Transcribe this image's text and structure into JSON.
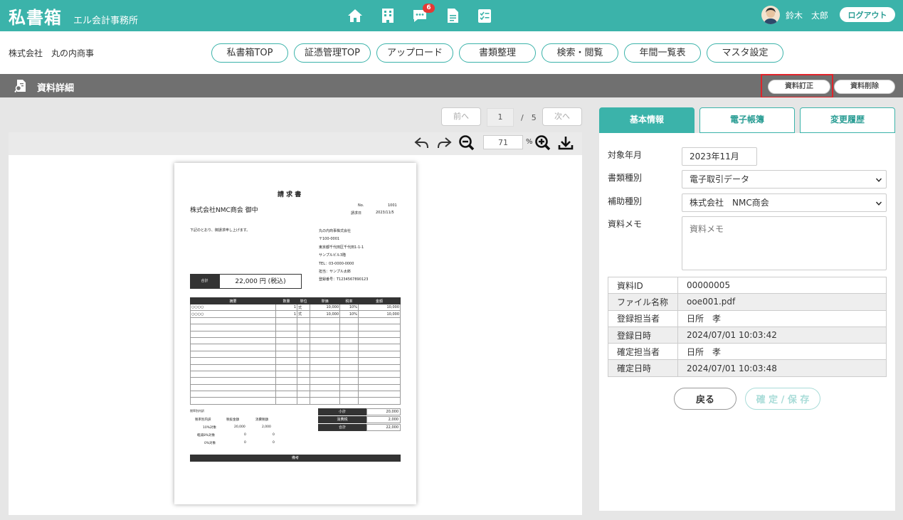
{
  "header": {
    "app_title": "私書箱",
    "office_name": "エル会計事務所",
    "notification_count": "6",
    "icons": [
      "home-icon",
      "building-icon",
      "chat-icon",
      "document-icon",
      "checklist-icon"
    ],
    "user_name": "鈴木　太郎",
    "logout_label": "ログアウト",
    "accent_color": "#3bb3aa"
  },
  "nav": {
    "company_name": "株式会社　丸の内商事",
    "items": [
      "私書箱TOP",
      "証憑管理TOP",
      "アップロード",
      "書類整理",
      "検索・閲覧",
      "年間一覧表",
      "マスタ設定"
    ]
  },
  "section": {
    "title": "資料詳細",
    "correct_label": "資料訂正",
    "delete_label": "資料削除"
  },
  "viewer": {
    "prev_label": "前へ",
    "next_label": "次へ",
    "current_page": "1",
    "total_pages": "/　5",
    "zoom_value": "71",
    "zoom_unit": "%"
  },
  "invoice": {
    "title": "請 求 書",
    "recipient": "株式会社NMC商会 御中",
    "no_label": "No.",
    "no_value": "1001",
    "date_label": "請求日",
    "date_value": "2023/11/5",
    "greeting": "下記のとおり、御請求申し上げます。",
    "sender_lines": [
      "丸の内商事株式会社",
      "〒100-0001",
      "東京都千代田区千代田1-1-1",
      "サンプルビル3階",
      "TEL：03-0000-0000",
      "担当：サンプル太郎",
      "登録番号：T1234567890123"
    ],
    "total_label": "合計",
    "total_value": "22,000 円 (税込)",
    "columns": [
      "摘要",
      "数量",
      "単位",
      "単価",
      "税率",
      "金額"
    ],
    "rows": [
      [
        "○○○○",
        "1",
        "式",
        "10,000",
        "10%",
        "10,000"
      ],
      [
        "○○○○",
        "1",
        "式",
        "10,000",
        "10%",
        "10,000"
      ]
    ],
    "tax_breakdown_title": "税率別内訳",
    "tax_breakdown_headers": [
      "税率別内訳",
      "税抜金額",
      "消費税額"
    ],
    "tax_rows": [
      [
        "10%対象",
        "20,000",
        "2,000"
      ],
      [
        "軽減8%対象",
        "0",
        "0"
      ],
      [
        "0%対象",
        "0",
        "0"
      ]
    ],
    "subtotal_label": "小計",
    "subtotal_value": "20,000",
    "tax_label": "消費税",
    "tax_value": "2,000",
    "grand_label": "合計",
    "grand_value": "22,000",
    "remarks_label": "備考"
  },
  "tabs": [
    "基本情報",
    "電子帳簿",
    "変更履歴"
  ],
  "form": {
    "month_label": "対象年月",
    "month_value": "2023年11月",
    "doc_type_label": "書類種別",
    "doc_type_value": "電子取引データ",
    "sub_type_label": "補助種別",
    "sub_type_value": "株式会社　NMC商会",
    "memo_label": "資料メモ",
    "memo_placeholder": "資料メモ"
  },
  "info": [
    [
      "資料ID",
      "00000005"
    ],
    [
      "ファイル名称",
      "ooe001.pdf"
    ],
    [
      "登録担当者",
      "日所　孝"
    ],
    [
      "登録日時",
      "2024/07/01 10:03:42"
    ],
    [
      "確定担当者",
      "日所　孝"
    ],
    [
      "確定日時",
      "2024/07/01 10:03:48"
    ]
  ],
  "actions": {
    "back_label": "戻る",
    "save_label": "確 定 / 保 存"
  }
}
